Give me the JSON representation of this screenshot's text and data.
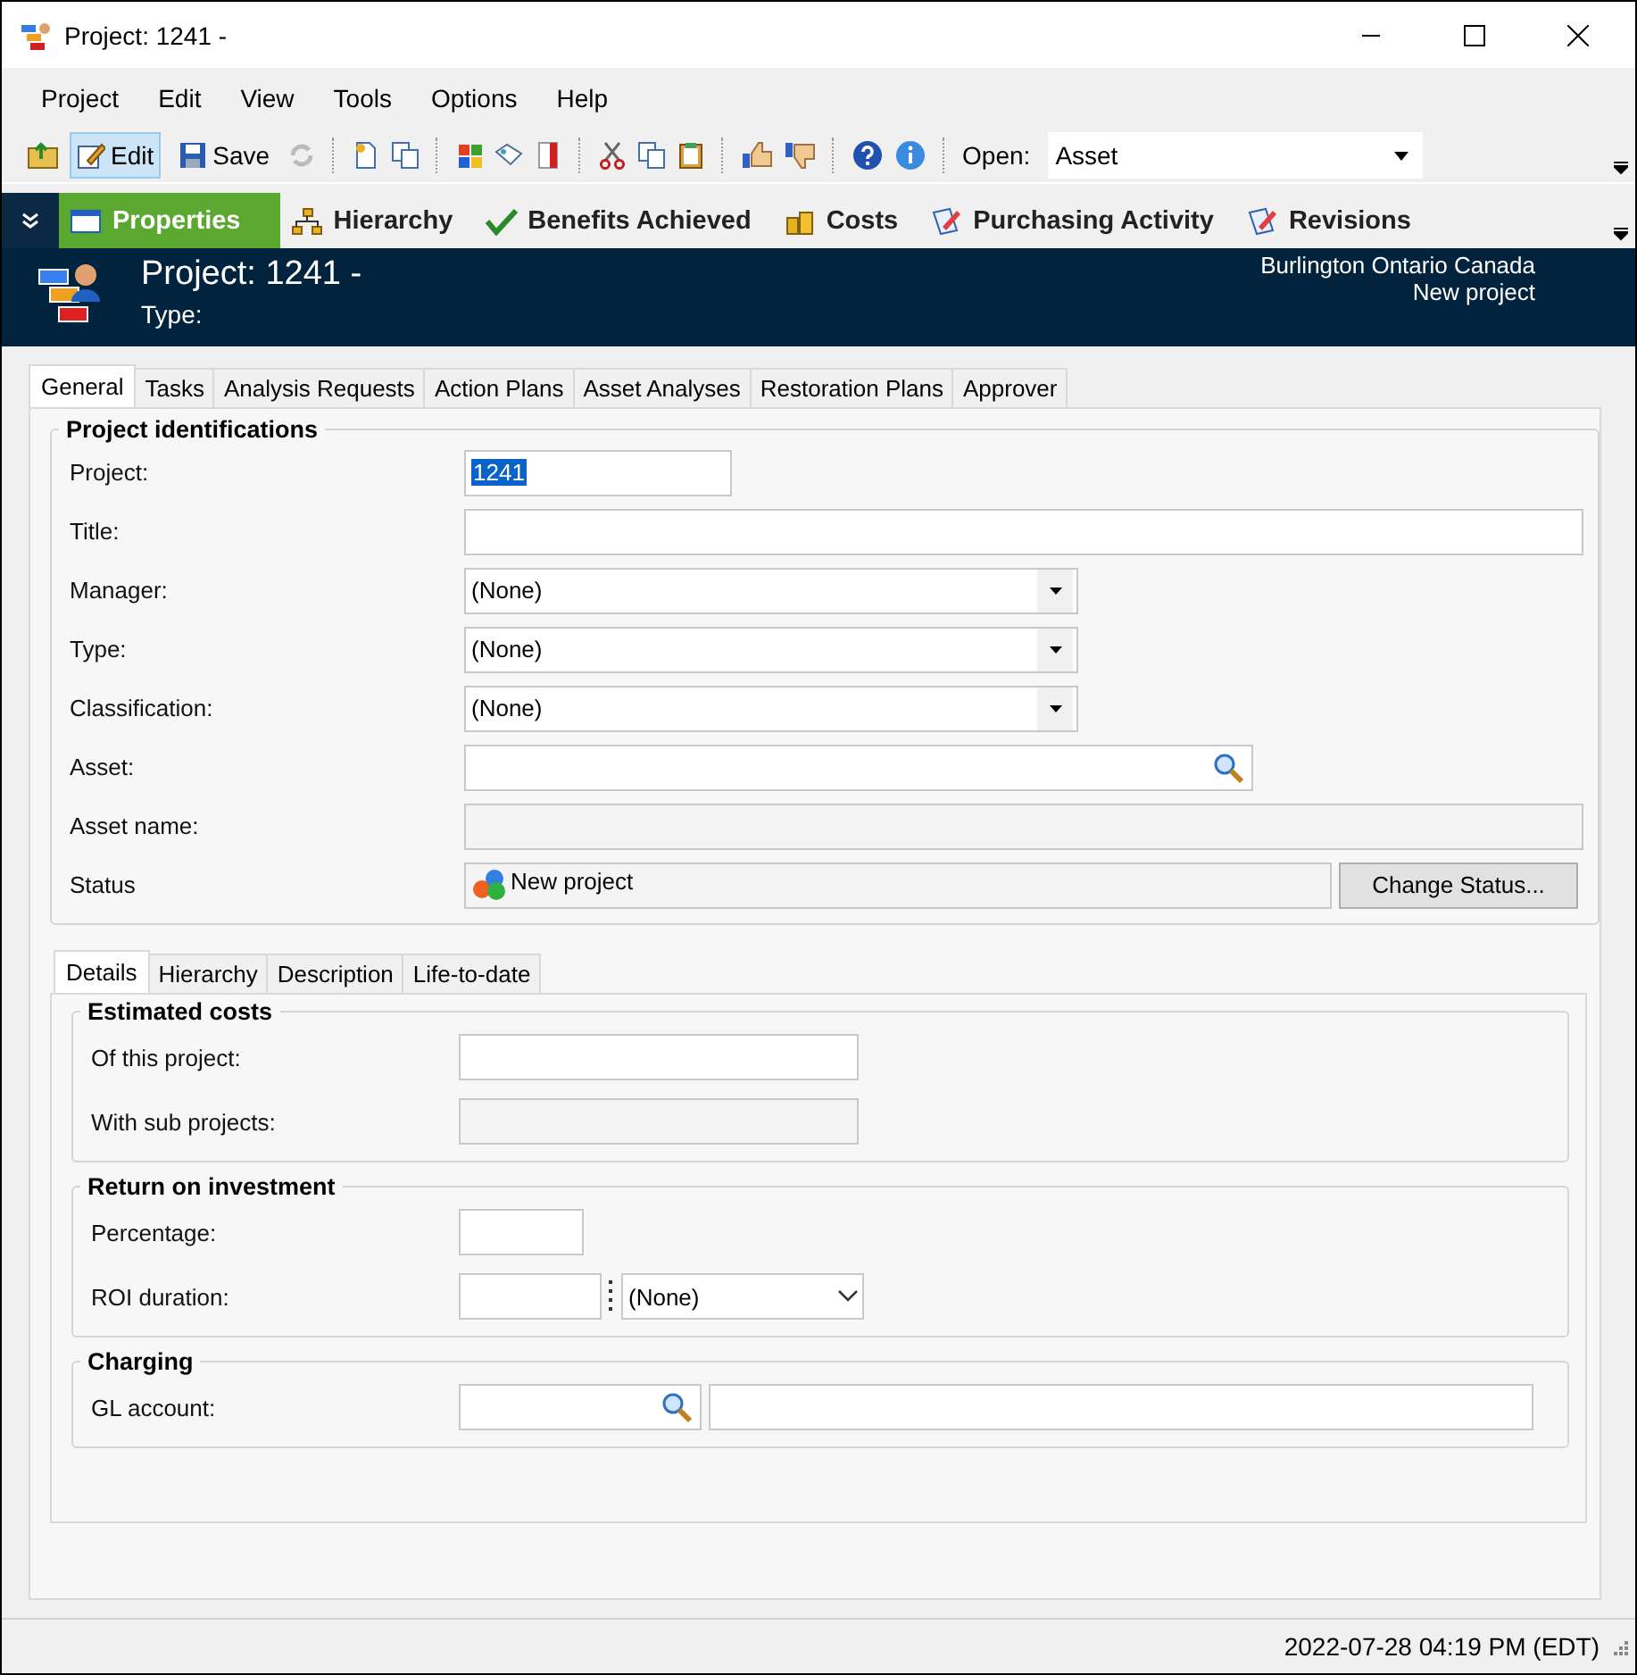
{
  "window": {
    "title": "Project: 1241 -"
  },
  "menu": [
    "Project",
    "Edit",
    "View",
    "Tools",
    "Options",
    "Help"
  ],
  "toolbar": {
    "buttons": [
      {
        "label": "Edit",
        "selected": true
      },
      {
        "label": "Save",
        "selected": false
      }
    ],
    "open_label": "Open:",
    "open_value": "Asset"
  },
  "nav_tabs": [
    {
      "label": "Properties",
      "selected": true
    },
    {
      "label": "Hierarchy",
      "selected": false
    },
    {
      "label": "Benefits Achieved",
      "selected": false
    },
    {
      "label": "Costs",
      "selected": false
    },
    {
      "label": "Purchasing Activity",
      "selected": false
    },
    {
      "label": "Revisions",
      "selected": false
    }
  ],
  "header": {
    "title": "Project: 1241 -",
    "type_label": "Type:",
    "location": "Burlington Ontario Canada",
    "status": "New project"
  },
  "tabs": [
    {
      "label": "General",
      "selected": true
    },
    {
      "label": "Tasks",
      "selected": false
    },
    {
      "label": "Analysis Requests",
      "selected": false
    },
    {
      "label": "Action Plans",
      "selected": false
    },
    {
      "label": "Asset Analyses",
      "selected": false
    },
    {
      "label": "Restoration Plans",
      "selected": false
    },
    {
      "label": "Approver",
      "selected": false
    }
  ],
  "identification": {
    "title": "Project identifications",
    "fields": [
      {
        "label": "Project:",
        "kind": "code",
        "value": "1241",
        "highlighted": true
      },
      {
        "label": "Title:",
        "kind": "text"
      },
      {
        "label": "Manager:",
        "kind": "combo",
        "value": "(None)"
      },
      {
        "label": "Type:",
        "kind": "combo",
        "value": "(None)"
      },
      {
        "label": "Classification:",
        "kind": "combo",
        "value": "(None)"
      },
      {
        "label": "Asset:",
        "kind": "lookup"
      },
      {
        "label": "Asset name:",
        "kind": "readonly"
      },
      {
        "label": "Status",
        "kind": "status",
        "value": "New project",
        "button": "Change Status..."
      }
    ]
  },
  "sub_tabs": [
    {
      "label": "Details",
      "selected": true
    },
    {
      "label": "Hierarchy",
      "selected": false
    },
    {
      "label": "Description",
      "selected": false
    },
    {
      "label": "Life-to-date",
      "selected": false
    }
  ],
  "groups": [
    {
      "title": "Estimated costs",
      "fields": [
        {
          "label": "Of this project:",
          "kind": "amount"
        },
        {
          "label": "With sub projects:",
          "kind": "amount_readonly"
        }
      ]
    },
    {
      "title": "Return on investment",
      "fields": [
        {
          "label": "Percentage:",
          "kind": "percent"
        },
        {
          "label": "ROI duration:",
          "kind": "duration",
          "value": "(None)"
        }
      ]
    },
    {
      "title": "Charging",
      "fields": [
        {
          "label": "GL account:",
          "kind": "account"
        }
      ]
    }
  ],
  "status_bar": {
    "time": "2022-07-28 04:19 PM (EDT)"
  }
}
